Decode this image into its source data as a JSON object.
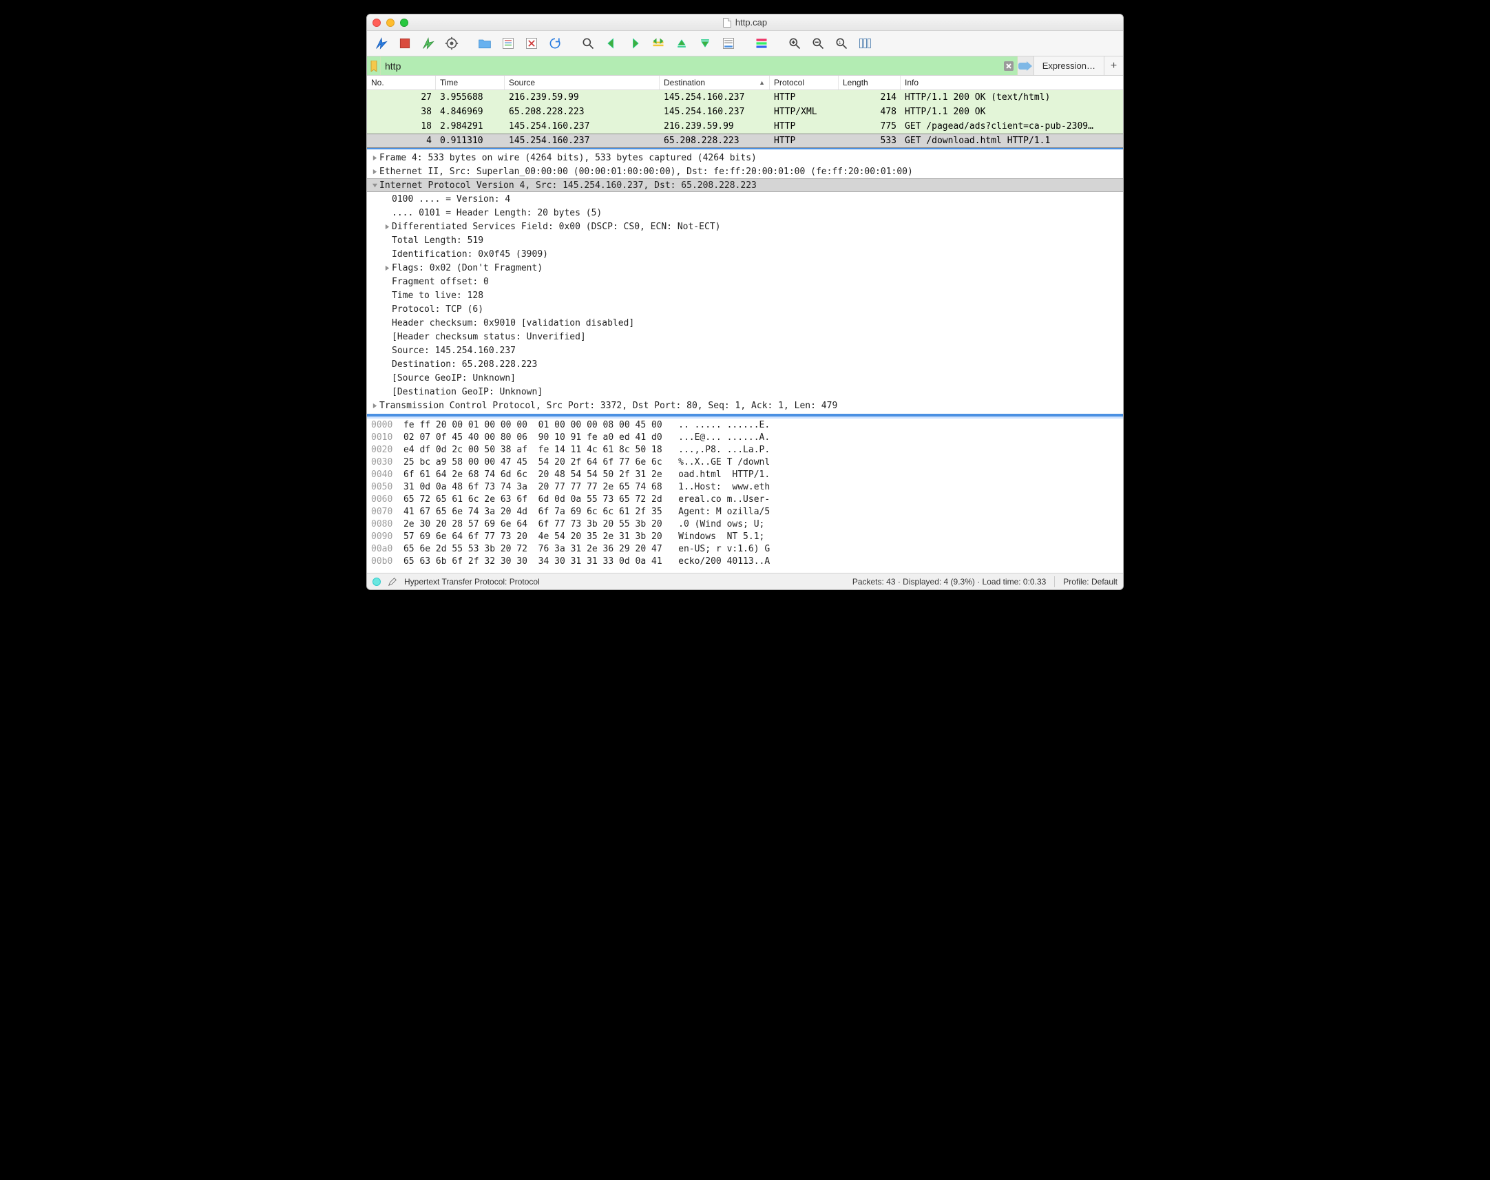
{
  "window": {
    "title": "http.cap"
  },
  "filter": {
    "value": "http",
    "expression_label": "Expression…"
  },
  "columns": {
    "no": "No.",
    "time": "Time",
    "src": "Source",
    "dst": "Destination",
    "proto": "Protocol",
    "len": "Length",
    "info": "Info"
  },
  "packets": [
    {
      "no": "27",
      "time": "3.955688",
      "src": "216.239.59.99",
      "dst": "145.254.160.237",
      "proto": "HTTP",
      "len": "214",
      "info": "HTTP/1.1 200 OK  (text/html)",
      "cls": "row-green"
    },
    {
      "no": "38",
      "time": "4.846969",
      "src": "65.208.228.223",
      "dst": "145.254.160.237",
      "proto": "HTTP/XML",
      "len": "478",
      "info": "HTTP/1.1 200 OK",
      "cls": "row-green"
    },
    {
      "no": "18",
      "time": "2.984291",
      "src": "145.254.160.237",
      "dst": "216.239.59.99",
      "proto": "HTTP",
      "len": "775",
      "info": "GET /pagead/ads?client=ca-pub-2309…",
      "cls": "row-green"
    },
    {
      "no": "4",
      "time": "0.911310",
      "src": "145.254.160.237",
      "dst": "65.208.228.223",
      "proto": "HTTP",
      "len": "533",
      "info": "GET /download.html HTTP/1.1",
      "cls": "row-sel row-sel-border"
    }
  ],
  "tree": [
    {
      "arrow": "right",
      "indent": 0,
      "text": "Frame 4: 533 bytes on wire (4264 bits), 533 bytes captured (4264 bits)"
    },
    {
      "arrow": "right",
      "indent": 0,
      "text": "Ethernet II, Src: Superlan_00:00:00 (00:00:01:00:00:00), Dst: fe:ff:20:00:01:00 (fe:ff:20:00:01:00)"
    },
    {
      "arrow": "down",
      "indent": 0,
      "text": "Internet Protocol Version 4, Src: 145.254.160.237, Dst: 65.208.228.223",
      "sel": true
    },
    {
      "arrow": "",
      "indent": 1,
      "text": "0100 .... = Version: 4"
    },
    {
      "arrow": "",
      "indent": 1,
      "text": ".... 0101 = Header Length: 20 bytes (5)"
    },
    {
      "arrow": "right",
      "indent": 1,
      "text": "Differentiated Services Field: 0x00 (DSCP: CS0, ECN: Not-ECT)"
    },
    {
      "arrow": "",
      "indent": 1,
      "text": "Total Length: 519"
    },
    {
      "arrow": "",
      "indent": 1,
      "text": "Identification: 0x0f45 (3909)"
    },
    {
      "arrow": "right",
      "indent": 1,
      "text": "Flags: 0x02 (Don't Fragment)"
    },
    {
      "arrow": "",
      "indent": 1,
      "text": "Fragment offset: 0"
    },
    {
      "arrow": "",
      "indent": 1,
      "text": "Time to live: 128"
    },
    {
      "arrow": "",
      "indent": 1,
      "text": "Protocol: TCP (6)"
    },
    {
      "arrow": "",
      "indent": 1,
      "text": "Header checksum: 0x9010 [validation disabled]"
    },
    {
      "arrow": "",
      "indent": 1,
      "text": "[Header checksum status: Unverified]"
    },
    {
      "arrow": "",
      "indent": 1,
      "text": "Source: 145.254.160.237"
    },
    {
      "arrow": "",
      "indent": 1,
      "text": "Destination: 65.208.228.223"
    },
    {
      "arrow": "",
      "indent": 1,
      "text": "[Source GeoIP: Unknown]"
    },
    {
      "arrow": "",
      "indent": 1,
      "text": "[Destination GeoIP: Unknown]"
    },
    {
      "arrow": "right",
      "indent": 0,
      "text": "Transmission Control Protocol, Src Port: 3372, Dst Port: 80, Seq: 1, Ack: 1, Len: 479"
    }
  ],
  "hex": [
    {
      "off": "0000",
      "b": "fe ff 20 00 01 00 00 00  01 00 00 00 08 00 45 00",
      "a": ".. ..... ......E."
    },
    {
      "off": "0010",
      "b": "02 07 0f 45 40 00 80 06  90 10 91 fe a0 ed 41 d0",
      "a": "...E@... ......A."
    },
    {
      "off": "0020",
      "b": "e4 df 0d 2c 00 50 38 af  fe 14 11 4c 61 8c 50 18",
      "a": "...,.P8. ...La.P."
    },
    {
      "off": "0030",
      "b": "25 bc a9 58 00 00 47 45  54 20 2f 64 6f 77 6e 6c",
      "a": "%..X..GE T /downl"
    },
    {
      "off": "0040",
      "b": "6f 61 64 2e 68 74 6d 6c  20 48 54 54 50 2f 31 2e",
      "a": "oad.html  HTTP/1."
    },
    {
      "off": "0050",
      "b": "31 0d 0a 48 6f 73 74 3a  20 77 77 77 2e 65 74 68",
      "a": "1..Host:  www.eth"
    },
    {
      "off": "0060",
      "b": "65 72 65 61 6c 2e 63 6f  6d 0d 0a 55 73 65 72 2d",
      "a": "ereal.co m..User-"
    },
    {
      "off": "0070",
      "b": "41 67 65 6e 74 3a 20 4d  6f 7a 69 6c 6c 61 2f 35",
      "a": "Agent: M ozilla/5"
    },
    {
      "off": "0080",
      "b": "2e 30 20 28 57 69 6e 64  6f 77 73 3b 20 55 3b 20",
      "a": ".0 (Wind ows; U; "
    },
    {
      "off": "0090",
      "b": "57 69 6e 64 6f 77 73 20  4e 54 20 35 2e 31 3b 20",
      "a": "Windows  NT 5.1; "
    },
    {
      "off": "00a0",
      "b": "65 6e 2d 55 53 3b 20 72  76 3a 31 2e 36 29 20 47",
      "a": "en-US; r v:1.6) G"
    },
    {
      "off": "00b0",
      "b": "65 63 6b 6f 2f 32 30 30  34 30 31 31 33 0d 0a 41",
      "a": "ecko/200 40113..A"
    }
  ],
  "status": {
    "left": "Hypertext Transfer Protocol: Protocol",
    "packets": "Packets: 43 · Displayed: 4 (9.3%) · Load time: 0:0.33",
    "profile": "Profile: Default"
  },
  "icons": {
    "fin": "fin",
    "stop": "stop",
    "restart": "restart",
    "options": "options",
    "open": "open",
    "save": "save",
    "close": "close",
    "reload": "reload",
    "find": "find",
    "back": "back",
    "fwd": "fwd",
    "jump": "jump",
    "first": "first",
    "last": "last",
    "autoscroll": "autoscroll",
    "colorize": "colorize",
    "zin": "zin",
    "zout": "zout",
    "z1": "z1",
    "resize": "resize"
  }
}
